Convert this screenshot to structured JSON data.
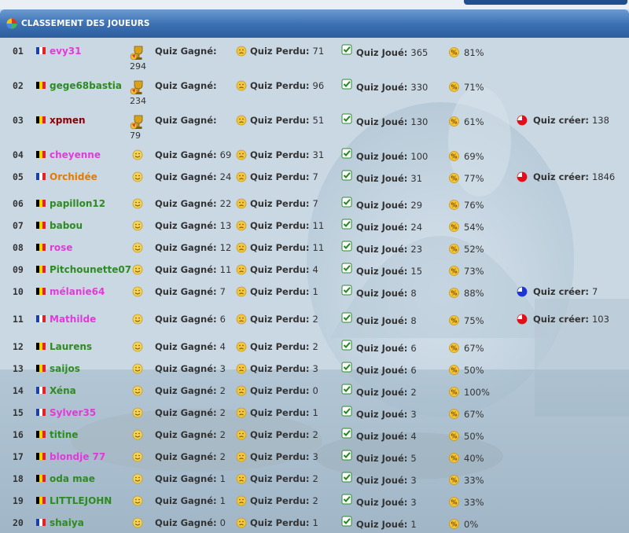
{
  "header": {
    "title": "CLASSEMENT DES JOUEURS"
  },
  "labels": {
    "gagne": "Quiz Gagné:",
    "perdu": "Quiz Perdu:",
    "joue": "Quiz Joué:",
    "cree": "Quiz créer:"
  },
  "flags": {
    "fr": [
      "#1f3fa8",
      "#ffffff",
      "#e0242c"
    ],
    "be": [
      "#000000",
      "#f5d300",
      "#e0242c"
    ]
  },
  "icons": {
    "smile": "smiley-icon",
    "perdu": "sad-face-icon",
    "joue": "checkmark-icon",
    "pct": "percent-icon",
    "cree": "pie-chart-icon",
    "trophy": "trophy-icon"
  },
  "players": [
    {
      "rank": "01",
      "flag": "fr",
      "name": "evy31",
      "color": "pink",
      "trophy": "294",
      "gagne": "",
      "perdu": "71",
      "joue": "365",
      "pct": "81%",
      "cree": ""
    },
    {
      "rank": "02",
      "flag": "be",
      "name": "gege68bastia",
      "color": "green",
      "trophy": "234",
      "gagne": "",
      "perdu": "96",
      "joue": "330",
      "pct": "71%",
      "cree": ""
    },
    {
      "rank": "03",
      "flag": "be",
      "name": "xpmen",
      "color": "dark",
      "trophy": "79",
      "gagne": "",
      "perdu": "51",
      "joue": "130",
      "pct": "61%",
      "cree": "138",
      "creeColor": "red"
    },
    {
      "rank": "04",
      "flag": "be",
      "name": "cheyenne",
      "color": "pink",
      "trophy": "",
      "gagne": "69",
      "perdu": "31",
      "joue": "100",
      "pct": "69%",
      "cree": ""
    },
    {
      "rank": "05",
      "flag": "fr",
      "name": "Orchidée",
      "color": "orange",
      "trophy": "",
      "gagne": "24",
      "perdu": "7",
      "joue": "31",
      "pct": "77%",
      "cree": "1846",
      "creeColor": "red"
    },
    {
      "rank": "06",
      "flag": "be",
      "name": "papillon12",
      "color": "green",
      "trophy": "",
      "gagne": "22",
      "perdu": "7",
      "joue": "29",
      "pct": "76%",
      "cree": ""
    },
    {
      "rank": "07",
      "flag": "be",
      "name": "babou",
      "color": "green",
      "trophy": "",
      "gagne": "13",
      "perdu": "11",
      "joue": "24",
      "pct": "54%",
      "cree": ""
    },
    {
      "rank": "08",
      "flag": "be",
      "name": "rose",
      "color": "pink",
      "trophy": "",
      "gagne": "12",
      "perdu": "11",
      "joue": "23",
      "pct": "52%",
      "cree": ""
    },
    {
      "rank": "09",
      "flag": "be",
      "name": "Pitchounette07",
      "color": "green",
      "trophy": "",
      "gagne": "11",
      "perdu": "4",
      "joue": "15",
      "pct": "73%",
      "cree": ""
    },
    {
      "rank": "10",
      "flag": "be",
      "name": "mélanie64",
      "color": "pink",
      "trophy": "",
      "gagne": "7",
      "perdu": "1",
      "joue": "8",
      "pct": "88%",
      "cree": "7",
      "creeColor": "blue"
    },
    {
      "rank": "11",
      "flag": "fr",
      "name": "Mathilde",
      "color": "pink",
      "trophy": "",
      "gagne": "6",
      "perdu": "2",
      "joue": "8",
      "pct": "75%",
      "cree": "103",
      "creeColor": "red"
    },
    {
      "rank": "12",
      "flag": "be",
      "name": "Laurens",
      "color": "green",
      "trophy": "",
      "gagne": "4",
      "perdu": "2",
      "joue": "6",
      "pct": "67%",
      "cree": ""
    },
    {
      "rank": "13",
      "flag": "be",
      "name": "saijos",
      "color": "green",
      "trophy": "",
      "gagne": "3",
      "perdu": "3",
      "joue": "6",
      "pct": "50%",
      "cree": ""
    },
    {
      "rank": "14",
      "flag": "fr",
      "name": "Xéna",
      "color": "green",
      "trophy": "",
      "gagne": "2",
      "perdu": "0",
      "joue": "2",
      "pct": "100%",
      "cree": ""
    },
    {
      "rank": "15",
      "flag": "fr",
      "name": "Sylver35",
      "color": "pink",
      "trophy": "",
      "gagne": "2",
      "perdu": "1",
      "joue": "3",
      "pct": "67%",
      "cree": ""
    },
    {
      "rank": "16",
      "flag": "be",
      "name": "titine",
      "color": "green",
      "trophy": "",
      "gagne": "2",
      "perdu": "2",
      "joue": "4",
      "pct": "50%",
      "cree": ""
    },
    {
      "rank": "17",
      "flag": "be",
      "name": "blondje 77",
      "color": "pink",
      "trophy": "",
      "gagne": "2",
      "perdu": "3",
      "joue": "5",
      "pct": "40%",
      "cree": ""
    },
    {
      "rank": "18",
      "flag": "be",
      "name": "oda mae",
      "color": "green",
      "trophy": "",
      "gagne": "1",
      "perdu": "2",
      "joue": "3",
      "pct": "33%",
      "cree": ""
    },
    {
      "rank": "19",
      "flag": "be",
      "name": "LITTLEJOHN",
      "color": "green",
      "trophy": "",
      "gagne": "1",
      "perdu": "2",
      "joue": "3",
      "pct": "33%",
      "cree": ""
    },
    {
      "rank": "20",
      "flag": "fr",
      "name": "shaiya",
      "color": "green",
      "trophy": "",
      "gagne": "0",
      "perdu": "1",
      "joue": "1",
      "pct": "0%",
      "cree": ""
    }
  ]
}
